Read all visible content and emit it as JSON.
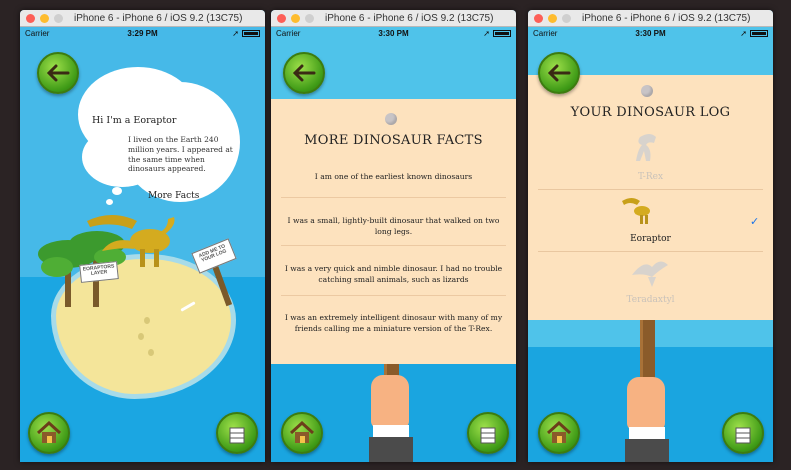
{
  "windows": [
    {
      "title": "iPhone 6 - iPhone 6 / iOS 9.2 (13C75)",
      "status": {
        "carrier": "Carrier",
        "time": "3:29 PM"
      },
      "screen": {
        "bubble_name": "Hi I'm a Eoraptor",
        "bubble_text": "I lived on the Earth 240 million years. I appeared at the same time when dinosaurs appeared.",
        "more_link": "More Facts",
        "sign_left": "EORAPTORS LAYER",
        "sign_right": "ADD ME TO YOUR LOG"
      }
    },
    {
      "title": "iPhone 6 - iPhone 6 / iOS 9.2 (13C75)",
      "status": {
        "carrier": "Carrier",
        "time": "3:30 PM"
      },
      "screen": {
        "heading": "MORE DINOSAUR FACTS",
        "facts": [
          "I am one of the earliest known dinosaurs",
          "I was a small, lightly-built dinosaur that walked on two long legs.",
          "I was a very quick and nimble dinosaur. I had no trouble catching small animals, such as lizards",
          "I was an extremely intelligent dinosaur with many of my friends calling me a miniature version of the T-Rex."
        ]
      }
    },
    {
      "title": "iPhone 6 - iPhone 6 / iOS 9.2 (13C75)",
      "status": {
        "carrier": "Carrier",
        "time": "3:30 PM"
      },
      "screen": {
        "heading": "YOUR DINOSAUR LOG",
        "log": [
          {
            "name": "T-Rex",
            "selected": false
          },
          {
            "name": "Eoraptor",
            "selected": true
          },
          {
            "name": "Teradaxtyl",
            "selected": false
          }
        ]
      }
    }
  ],
  "icons": {
    "back": "back-arrow-icon",
    "home": "home-icon",
    "log": "log-book-icon",
    "checkmark": "checkmark-icon"
  },
  "colors": {
    "sky": "#46b9e8",
    "sea": "#1ba6e2",
    "paper": "#fde2be",
    "button_green": "#3e9a16",
    "check_blue": "#1a73e8"
  }
}
